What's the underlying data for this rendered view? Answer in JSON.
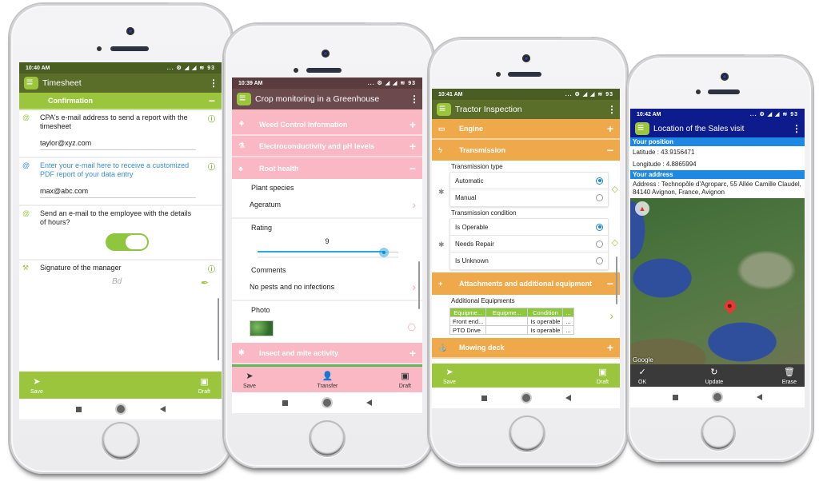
{
  "phones": [
    {
      "status_time": "10:40 AM",
      "status_icons": "... ⚙ ◢ ◢ ≋ 93",
      "app_title": "Timesheet",
      "colors": {
        "statusbar": "#4a5d23",
        "appbar": "#5a6e2a",
        "section": "#9bc53d",
        "bottombar": "#9bc53d"
      },
      "section": {
        "label": "Confirmation",
        "toggle": "−"
      },
      "fields": [
        {
          "label": "CPA's e-mail address to send a report with the timesheet",
          "value": "taylor@xyz.com"
        },
        {
          "label": "Enter your e-mail here to receive a customized PDF report of your data entry",
          "value": "max@abc.com"
        },
        {
          "label": "Send an e-mail to the employee with the details of hours?",
          "switch_on": true
        },
        {
          "label": "Signature of the manager",
          "signature": "Bd"
        }
      ],
      "bottom": {
        "left": "Save",
        "right": "Draft"
      }
    },
    {
      "status_time": "10:39 AM",
      "status_icons": "... ⚙ ◢ ◢ ≋ 93",
      "app_title": "Crop monitoring in a Greenhouse",
      "colors": {
        "statusbar": "#5a3c3f",
        "appbar": "#6b4a4d",
        "section": "#f9b8c3",
        "bottombar": "#f9b8c3",
        "extra_section": "#5cb85c"
      },
      "sections": [
        {
          "label": "Weed Control Information",
          "toggle": "+"
        },
        {
          "label": "Electroconductivity and pH levels",
          "toggle": "+"
        },
        {
          "label": "Root health",
          "toggle": "−"
        }
      ],
      "plant_species_label": "Plant species",
      "plant_species_value": "Ageratum",
      "rating_label": "Rating",
      "rating_value": "9",
      "rating_fraction": 0.9,
      "comments_label": "Comments",
      "comments_value": "No pests and no infections",
      "photo_label": "Photo",
      "insect_section": {
        "label": "Insect and mite activity",
        "toggle": "+"
      },
      "bottom": {
        "left": "Save",
        "middle": "Transfer",
        "right": "Draft"
      }
    },
    {
      "status_time": "10:41 AM",
      "status_icons": "... ⚙ ◢ ◢ ≋ 93",
      "app_title": "Tractor Inspection",
      "colors": {
        "statusbar": "#4a5d23",
        "appbar": "#5a6e2a",
        "section": "#f0a94a",
        "bottombar": "#9bc53d"
      },
      "sections": [
        {
          "label": "Engine",
          "toggle": "+"
        },
        {
          "label": "Transmission",
          "toggle": "−"
        }
      ],
      "transmission_type": {
        "label": "Transmission type",
        "options": [
          "Automatic",
          "Manual"
        ],
        "selected": 0
      },
      "transmission_condition": {
        "label": "Transmission condition",
        "options": [
          "Is Operable",
          "Needs Repair",
          "Is Unknown"
        ],
        "selected": 0
      },
      "attachments_section": {
        "label": "Attachments and additional equipment",
        "toggle": "−"
      },
      "equipments": {
        "label": "Additional Equipments",
        "headers": [
          "Equipme...",
          "Equipme...",
          "Condition",
          "..."
        ],
        "rows": [
          [
            "Front end...",
            "",
            "Is operable",
            "..."
          ],
          [
            "PTO Drive",
            "",
            "Is operable",
            "..."
          ]
        ]
      },
      "mowing_section": {
        "label": "Mowing deck",
        "toggle": "+"
      },
      "bottom": {
        "left": "Save",
        "right": "Draft"
      }
    },
    {
      "status_time": "10:42 AM",
      "status_icons": "... ⚙ ◢ ◢ ≋ 93",
      "app_title": "Location of the Sales visit",
      "colors": {
        "statusbar": "#0d1b8c",
        "appbar": "#0d1b8c",
        "header": "#1e88e5",
        "bottombar": "#3a3a3a"
      },
      "position_header": "Your position",
      "latitude": "Latitude : 43.9156471",
      "longitude": "Longitude : 4.8865994",
      "address_header": "Your address",
      "address": "Address : Technopôle d'Agroparc, 55 Allée Camille Claudel, 84140 Avignon, France, Avignon",
      "map_attribution": "Google",
      "bottom": {
        "left": "OK",
        "middle": "Update",
        "right": "Erase"
      }
    }
  ]
}
